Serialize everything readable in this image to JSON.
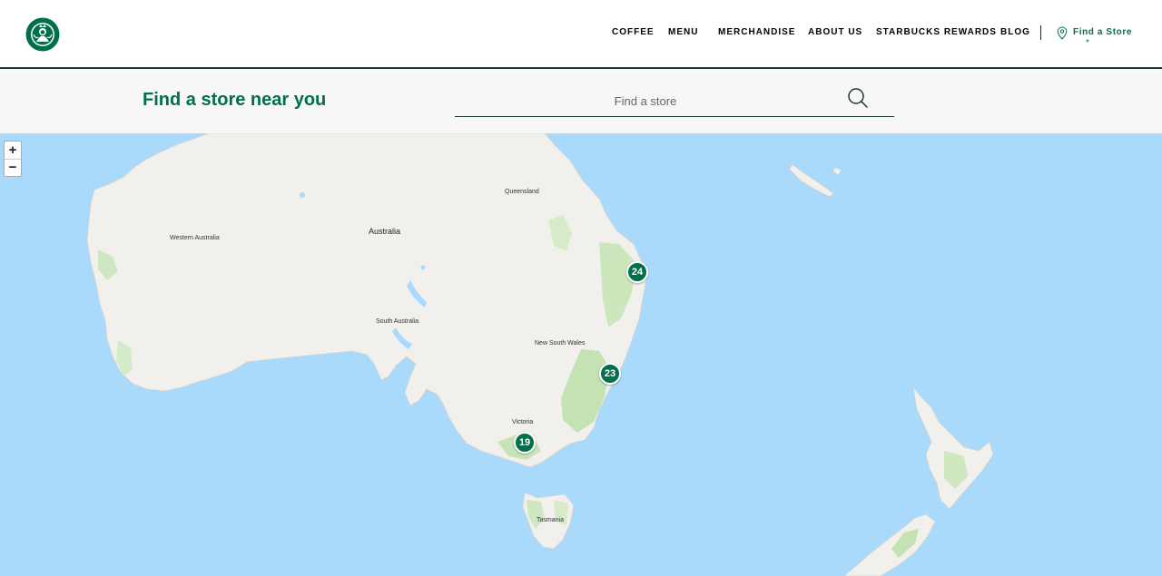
{
  "header": {
    "nav": [
      {
        "label": "COFFEE"
      },
      {
        "label": "MENU"
      },
      {
        "label": "MERCHANDISE"
      },
      {
        "label": "ABOUT US"
      },
      {
        "label": "STARBUCKS REWARDS"
      },
      {
        "label": "BLOG"
      }
    ],
    "find_store_label": "Find a Store",
    "find_store_mark": "*"
  },
  "search": {
    "title": "Find a store near you",
    "placeholder": "Find a store"
  },
  "map": {
    "zoom_in": "+",
    "zoom_out": "−",
    "labels": {
      "australia": "Australia",
      "western_australia": "Western Australia",
      "queensland": "Queensland",
      "south_australia": "South Australia",
      "new_south_wales": "New South Wales",
      "victoria": "Victoria",
      "tasmania": "Tasmania"
    },
    "clusters": [
      {
        "count": "24"
      },
      {
        "count": "23"
      },
      {
        "count": "19"
      }
    ]
  },
  "colors": {
    "brand_green": "#00704a",
    "house_green": "#1e3932",
    "water": "#a9d9fb",
    "land": "#f2f0ec"
  }
}
